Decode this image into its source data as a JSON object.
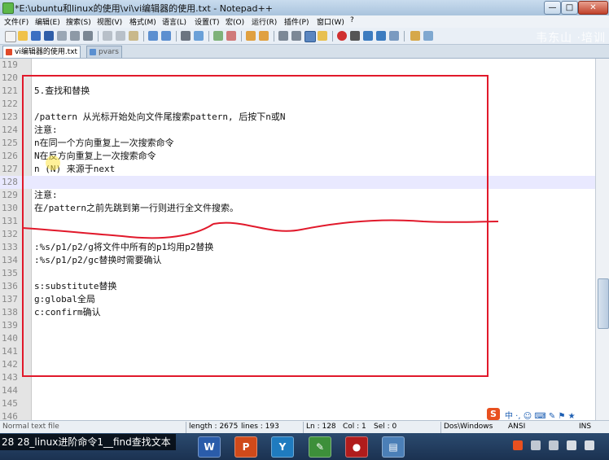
{
  "window": {
    "title": "*E:\\ubuntu和linux的使用\\vi\\vi编辑器的使用.txt - Notepad++",
    "controls": {
      "minimize": "—",
      "maximize": "□",
      "close": "✕"
    }
  },
  "menu": [
    "文件(F)",
    "编辑(E)",
    "搜索(S)",
    "视图(V)",
    "格式(M)",
    "语言(L)",
    "设置(T)",
    "宏(O)",
    "运行(R)",
    "插件(P)",
    "窗口(W)",
    "?"
  ],
  "watermark": "韦东山 ·培训",
  "tabs": [
    {
      "label": "vi编辑器的使用.txt",
      "active": true,
      "icon": "modified-file-icon",
      "color": "#e04a2a"
    },
    {
      "label": "pvars",
      "active": false,
      "icon": "file-icon",
      "color": "#5a8fd0"
    }
  ],
  "editor": {
    "current_line": 128,
    "lines": [
      {
        "n": "119",
        "text": ""
      },
      {
        "n": "120",
        "text": ""
      },
      {
        "n": "121",
        "text": "5.查找和替换"
      },
      {
        "n": "122",
        "text": ""
      },
      {
        "n": "123",
        "text": "/pattern 从光标开始处向文件尾搜索pattern, 后按下n或N"
      },
      {
        "n": "124",
        "text": "注意:"
      },
      {
        "n": "125",
        "text": "n在同一个方向重复上一次搜索命令"
      },
      {
        "n": "126",
        "text": "N在反方向重复上一次搜索命令"
      },
      {
        "n": "127",
        "text": "n (N) 来源于next"
      },
      {
        "n": "128",
        "text": ""
      },
      {
        "n": "129",
        "text": "注意:"
      },
      {
        "n": "130",
        "text": "在/pattern之前先跳到第一行则进行全文件搜索。"
      },
      {
        "n": "131",
        "text": ""
      },
      {
        "n": "132",
        "text": ""
      },
      {
        "n": "133",
        "text": ":%s/p1/p2/g将文件中所有的p1均用p2替换"
      },
      {
        "n": "134",
        "text": ":%s/p1/p2/gc替换时需要确认"
      },
      {
        "n": "135",
        "text": ""
      },
      {
        "n": "136",
        "text": "s:substitute替换"
      },
      {
        "n": "137",
        "text": "g:global全局"
      },
      {
        "n": "138",
        "text": "c:confirm确认"
      },
      {
        "n": "139",
        "text": ""
      },
      {
        "n": "140",
        "text": ""
      },
      {
        "n": "141",
        "text": ""
      },
      {
        "n": "142",
        "text": ""
      },
      {
        "n": "143",
        "text": ""
      },
      {
        "n": "144",
        "text": ""
      },
      {
        "n": "145",
        "text": ""
      },
      {
        "n": "146",
        "text": ""
      }
    ]
  },
  "status": {
    "doc_type": "Normal text file",
    "length": "length : 2675",
    "lines": "lines : 193",
    "ln": "Ln : 128",
    "col": "Col : 1",
    "sel": "Sel : 0",
    "eol": "Dos\\Windows",
    "encoding": "ANSI",
    "mode": "INS"
  },
  "ime": {
    "logo": "S",
    "glyphs": "中 ·, ☺ ⌨ ✎ ⚑ ★"
  },
  "taskbar": {
    "caption": "28 28_linux进阶命令1__find查找文本",
    "apps": [
      {
        "label": "W",
        "color": "#2a5caa",
        "icon": "word-icon"
      },
      {
        "label": "P",
        "color": "#d04a1a",
        "icon": "powerpoint-icon"
      },
      {
        "label": "Y",
        "color": "#1f7bbf",
        "icon": "app-y-icon"
      },
      {
        "label": "✎",
        "color": "#3d8f3a",
        "icon": "notepad-icon"
      },
      {
        "label": "●",
        "color": "#b01c1c",
        "icon": "recorder-icon"
      },
      {
        "label": "▤",
        "color": "#4b7fb7",
        "icon": "app-icon"
      }
    ],
    "tray_icons": [
      "ime-tray-icon",
      "network-icon",
      "volume-icon",
      "flag-icon"
    ]
  },
  "colors": {
    "annotation": "#e1192b",
    "current_line": "#e9e9ff",
    "cursor_highlight": "#ffe646"
  }
}
